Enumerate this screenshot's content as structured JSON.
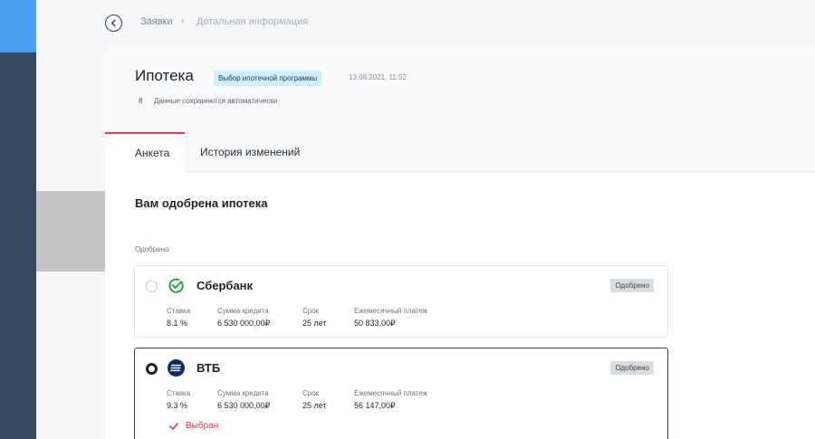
{
  "breadcrumb": {
    "parent": "Заявки",
    "separator": "‹",
    "current": "Детальная информация"
  },
  "header": {
    "title": "Ипотека",
    "program_badge": "Выбор ипотечной программы",
    "timestamp": "13.08.2021, 11:52",
    "autosave_icon": "8",
    "autosave_text": "Данные сохраняются автоматически"
  },
  "tabs": [
    {
      "label": "Анкета",
      "active": true
    },
    {
      "label": "История изменений",
      "active": false
    }
  ],
  "main": {
    "section_title": "Вам одобрена ипотека",
    "group_label": "Одобрено",
    "field_labels": {
      "rate": "Ставка",
      "sum": "Сумма кредита",
      "term": "Срок",
      "payment": "Ежемесячный платеж"
    },
    "offers": [
      {
        "bank": "Сбербанк",
        "logo_icon": "sberbank-logo-icon",
        "status": "Одобрено",
        "rate": "8.1 %",
        "sum": "6 530 000,00₽",
        "term": "25 лет",
        "payment": "50 833,00₽",
        "selected": false
      },
      {
        "bank": "ВТБ",
        "logo_icon": "vtb-logo-icon",
        "status": "Одобрено",
        "rate": "9.3 %",
        "sum": "6 530 000,00₽",
        "term": "25 лет",
        "payment": "56 147,00₽",
        "selected": true,
        "selected_label": "Выбран"
      }
    ]
  },
  "colors": {
    "accent": "#e53945",
    "rail": "#334a5e",
    "rail_top": "#4a9ef0",
    "badge_bg": "#cdeefa"
  }
}
